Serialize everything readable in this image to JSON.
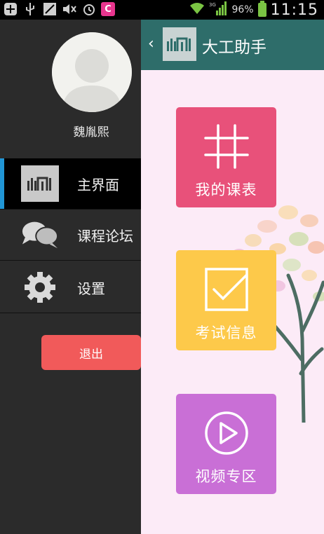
{
  "status_bar": {
    "battery_percent": "96%",
    "time": "11:15",
    "network": "3G"
  },
  "drawer": {
    "username": "魏胤熙",
    "menu": [
      {
        "label": "主界面",
        "icon": "home-logo-icon",
        "active": true
      },
      {
        "label": "课程论坛",
        "icon": "chat-bubbles-icon",
        "active": false
      },
      {
        "label": "设置",
        "icon": "gear-icon",
        "active": false
      }
    ],
    "logout_label": "退出"
  },
  "main": {
    "title": "大工助手",
    "tiles": [
      {
        "label": "我的课表",
        "icon": "grid-icon",
        "color": "#e8517a"
      },
      {
        "label": "考试信息",
        "icon": "checkbox-icon",
        "color": "#fdc94a"
      },
      {
        "label": "视频专区",
        "icon": "play-icon",
        "color": "#c96fd6"
      }
    ]
  },
  "colors": {
    "actionbar": "#2e6d6a",
    "drawer_bg": "#2b2b2b",
    "active_indicator": "#2196d6",
    "logout": "#f15a5a",
    "main_bg": "#fcebf7"
  }
}
